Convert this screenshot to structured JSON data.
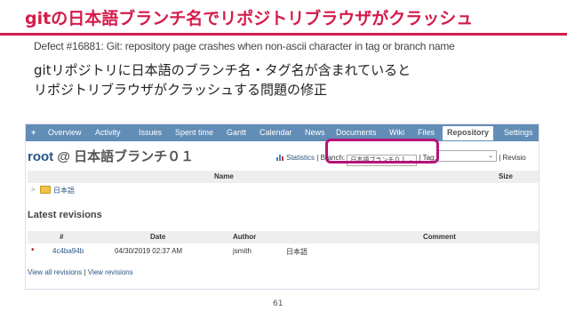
{
  "slide": {
    "title": "gitの日本語ブランチ名でリポジトリブラウザがクラッシュ",
    "subtitle": "Defect #16881: Git: repository page crashes when non-ascii character in tag or branch name",
    "body_line1": "gitリポジトリに日本語のブランチ名・タグ名が含まれていると",
    "body_line2": "リポジトリブラウザがクラッシュする問題の修正",
    "page_number": "61"
  },
  "menu": {
    "plus": "+",
    "tabs": [
      "Overview",
      "Activity",
      "Issues",
      "Spent time",
      "Gantt",
      "Calendar",
      "News",
      "Documents",
      "Wiki",
      "Files",
      "Repository",
      "Settings"
    ],
    "active_tab": "Repository"
  },
  "repo": {
    "root": "root",
    "title_rest": "@ 日本語ブランチ０１",
    "statistics": "Statistics",
    "separator": "|",
    "branch_label": "Branch:",
    "branch_value": "日本語ブランチ０１",
    "tag_label": "Tag:",
    "tag_value": "",
    "revision_label": "Revisio"
  },
  "file_table": {
    "col_name": "Name",
    "col_size": "Size",
    "rows": [
      {
        "name": "日本語"
      }
    ]
  },
  "latest_revisions": {
    "heading": "Latest revisions",
    "col_hash": "#",
    "col_date": "Date",
    "col_author": "Author",
    "col_comment": "Comment",
    "rows": [
      {
        "hash": "4c4ba94b",
        "date": "04/30/2019 02:37 AM",
        "author": "jsmith",
        "message": "日本語",
        "comment": ""
      }
    ]
  },
  "footer": {
    "view_all": "View all revisions",
    "separator": "|",
    "view_revisions": "View revisions"
  },
  "colors": {
    "accent": "#d51b4a",
    "menu_bar": "#628db6",
    "highlight": "#b5127a",
    "link": "#2a5685"
  }
}
